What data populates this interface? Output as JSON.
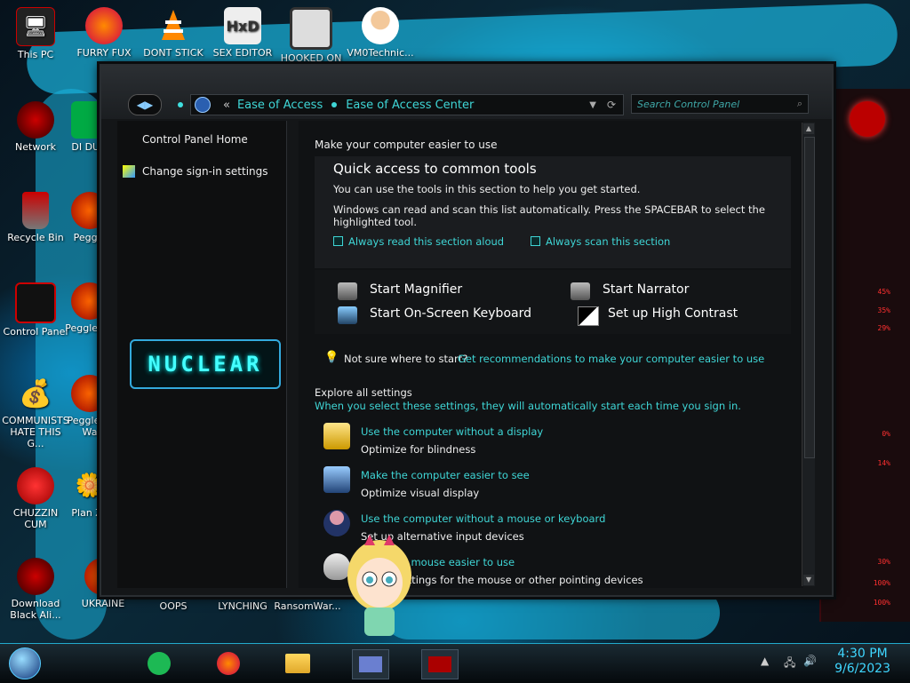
{
  "desktop": {
    "icons": [
      {
        "label": "This PC",
        "icon": "computer-icon"
      },
      {
        "label": "FURRY FUX",
        "icon": "firefox-icon"
      },
      {
        "label": "DONT STICK",
        "icon": "vlc-cone-icon"
      },
      {
        "label": "SEX EDITOR",
        "icon": "hxd-editor-icon"
      },
      {
        "label": "HOOKED ON",
        "icon": "game-icon"
      },
      {
        "label": "VM0Technic...",
        "icon": "doctor-icon"
      },
      {
        "label": "Network",
        "icon": "network-icon"
      },
      {
        "label": "DI DUM",
        "icon": "app-icon"
      },
      {
        "label": "Recycle Bin",
        "icon": "recycle-bin-icon"
      },
      {
        "label": "Peggle",
        "icon": "peggle-icon"
      },
      {
        "label": "Control Panel",
        "icon": "control-panel-icon"
      },
      {
        "label": "Peggle De",
        "icon": "peggle-icon"
      },
      {
        "label": "COMMUNISTS HATE THIS G...",
        "icon": "money-bag-icon"
      },
      {
        "label": "Peggle of Wa",
        "icon": "peggle-icon"
      },
      {
        "label": "CHUZZIN CUM",
        "icon": "chuzzle-icon"
      },
      {
        "label": "Plan Zo",
        "icon": "plant-icon"
      },
      {
        "label": "Download Black Ali...",
        "icon": "alien-icon"
      },
      {
        "label": "UKRAINE",
        "icon": "app-icon"
      },
      {
        "label": "OOPS",
        "icon": "app-icon"
      },
      {
        "label": "LYNCHING",
        "icon": "app-icon"
      },
      {
        "label": "RansomWar...",
        "icon": "app-icon"
      }
    ],
    "gauge_percents": [
      "45%",
      "35%",
      "29%",
      "0%",
      "14%",
      "30%",
      "100%",
      "100%"
    ]
  },
  "window": {
    "breadcrumb": {
      "overflow": "«",
      "items": [
        "Ease of Access",
        "Ease of Access Center"
      ]
    },
    "search_placeholder": "Search Control Panel",
    "left_pane": {
      "links": [
        "Control Panel Home",
        "Change sign-in settings"
      ],
      "logo_text": "NUCLEAR"
    },
    "main": {
      "heading": "Make your computer easier to use",
      "quick_access": {
        "title": "Quick access to common tools",
        "line1": "You can use the tools in this section to help you get started.",
        "line2": "Windows can read and scan this list automatically.  Press the SPACEBAR to select the",
        "line3": "highlighted tool.",
        "check_read": "Always read this section aloud",
        "check_scan": "Always scan this section"
      },
      "tools": {
        "magnifier": "Start Magnifier",
        "narrator": "Start Narrator",
        "keyboard": "Start On-Screen Keyboard",
        "contrast": "Set up High Contrast"
      },
      "hint": {
        "text": "Not sure where to start?",
        "link": "Get recommendations to make your computer easier to use"
      },
      "explore": {
        "title": "Explore all settings",
        "subtitle": "When you select these settings, they will automatically start each time you sign in.",
        "items": [
          {
            "link": "Use the computer without a display",
            "desc": "Optimize for blindness"
          },
          {
            "link": "Make the computer easier to see",
            "desc": "Optimize visual display"
          },
          {
            "link": "Use the computer without a mouse or keyboard",
            "desc": "Set up alternative input devices"
          },
          {
            "link": "Make the mouse easier to use",
            "desc": "Adjust settings for the mouse or other pointing devices"
          }
        ]
      }
    }
  },
  "taskbar": {
    "time": "4:30 PM",
    "date": "9/6/2023"
  },
  "colors": {
    "accent": "#3fd6d6",
    "window_bg": "#141618",
    "panel_bg": "#0e0f10"
  }
}
